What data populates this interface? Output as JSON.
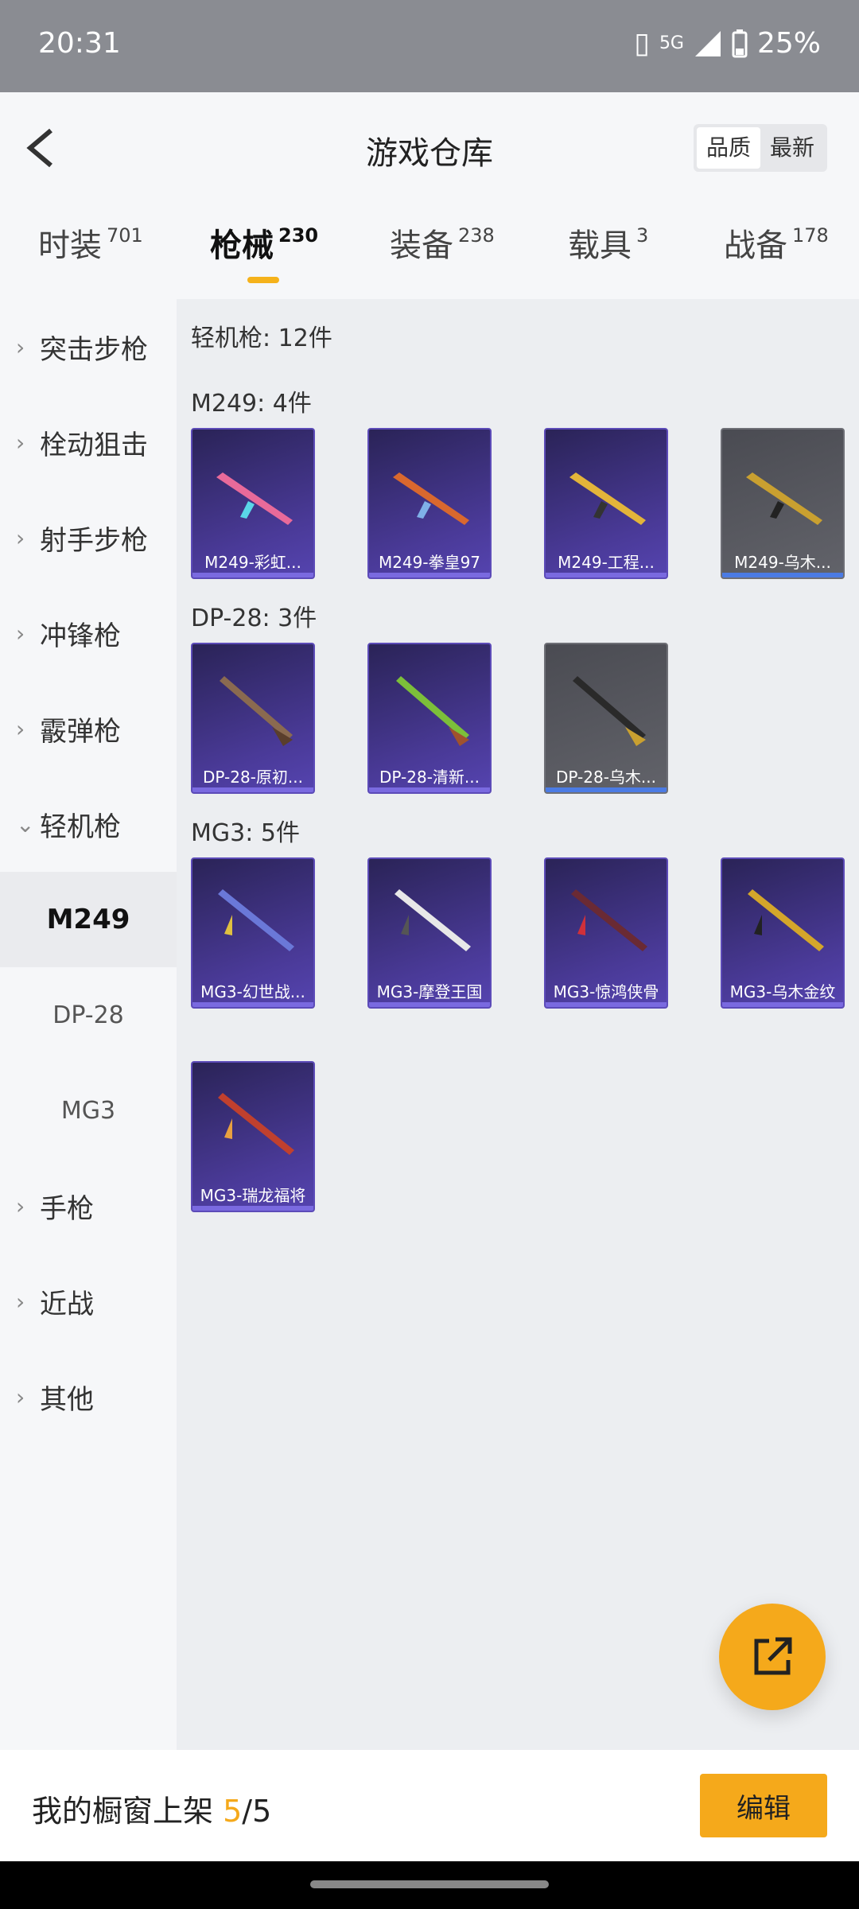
{
  "status": {
    "time": "20:31",
    "network": "5G",
    "battery": "25%"
  },
  "header": {
    "title": "游戏仓库",
    "sort": [
      "品质",
      "最新"
    ]
  },
  "tabs": [
    {
      "label": "时装",
      "count": "701"
    },
    {
      "label": "枪械",
      "count": "230"
    },
    {
      "label": "装备",
      "count": "238"
    },
    {
      "label": "载具",
      "count": "3"
    },
    {
      "label": "战备",
      "count": "178"
    }
  ],
  "sidebar": {
    "categories": [
      "突击步枪",
      "栓动狙击",
      "射手步枪",
      "冲锋枪",
      "霰弹枪",
      "轻机枪"
    ],
    "subs": [
      "M249",
      "DP-28",
      "MG3"
    ],
    "more": [
      "手枪",
      "近战",
      "其他"
    ]
  },
  "content": {
    "summary": "轻机枪: 12件",
    "groups": [
      {
        "label": "M249: 4件",
        "items": [
          "M249-彩虹...",
          "M249-拳皇97",
          "M249-工程...",
          "M249-乌木..."
        ]
      },
      {
        "label": "DP-28: 3件",
        "items": [
          "DP-28-原初...",
          "DP-28-清新...",
          "DP-28-乌木..."
        ]
      },
      {
        "label": "MG3: 5件",
        "items": [
          "MG3-幻世战...",
          "MG3-摩登王国",
          "MG3-惊鸿侠骨",
          "MG3-乌木金纹",
          "MG3-瑞龙福将"
        ]
      }
    ]
  },
  "bottom": {
    "shelf_label": "我的橱窗上架 ",
    "shelf_used": "5",
    "shelf_total": "/5",
    "edit_label": "编辑"
  }
}
